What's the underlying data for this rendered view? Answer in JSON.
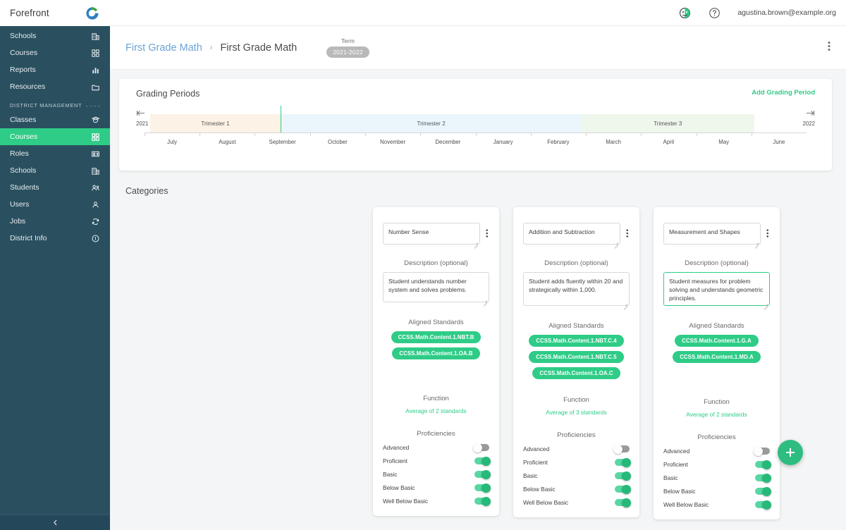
{
  "brand": {
    "name": "Forefront",
    "logo_icon": "forefront-logo-icon"
  },
  "sidebar": {
    "top_items": [
      {
        "label": "Schools",
        "icon": "building-icon"
      },
      {
        "label": "Courses",
        "icon": "grid-apps-icon"
      },
      {
        "label": "Reports",
        "icon": "bar-chart-icon"
      },
      {
        "label": "Resources",
        "icon": "folder-icon"
      }
    ],
    "section_label": "DISTRICT MANAGEMENT",
    "district_items": [
      {
        "label": "Classes",
        "icon": "graduation-cap-icon",
        "active": false
      },
      {
        "label": "Courses",
        "icon": "grid-apps-icon",
        "active": true
      },
      {
        "label": "Roles",
        "icon": "id-card-icon",
        "active": false
      },
      {
        "label": "Schools",
        "icon": "building-icon",
        "active": false
      },
      {
        "label": "Students",
        "icon": "users-icon",
        "active": false
      },
      {
        "label": "Users",
        "icon": "user-icon",
        "active": false
      },
      {
        "label": "Jobs",
        "icon": "refresh-icon",
        "active": false
      },
      {
        "label": "District Info",
        "icon": "info-circle-icon",
        "active": false
      }
    ],
    "collapse_icon": "chevron-left-icon",
    "active_color": "#2ecc87",
    "bg_color": "#2a5060"
  },
  "topbar": {
    "avatar_icon": "user-avatar-icon",
    "help_icon": "help-circle-icon",
    "user_email": "agustina.brown@example.org"
  },
  "pagehead": {
    "breadcrumb_link": "First Grade Math",
    "breadcrumb_separator": "›",
    "breadcrumb_current": "First Grade Math",
    "term_label": "Term",
    "term_value": "2021-2022",
    "menu_icon": "kebab-menu-icon"
  },
  "grading_periods": {
    "title": "Grading Periods",
    "add_label": "Add Grading Period",
    "start_year": "2021",
    "end_year": "2022",
    "start_cap_icon": "timeline-start-icon",
    "end_cap_icon": "timeline-end-icon",
    "months": [
      "July",
      "August",
      "September",
      "October",
      "November",
      "December",
      "January",
      "February",
      "March",
      "April",
      "May",
      "June"
    ],
    "bands": [
      {
        "label": "Trimester 1",
        "color": "#fdf2e6",
        "start_pct": 0.8,
        "end_pct": 20.6
      },
      {
        "label": "Trimester 2",
        "color": "#eaf6fb",
        "start_pct": 20.6,
        "end_pct": 66.0
      },
      {
        "label": "Trimester 3",
        "color": "#eff7ec",
        "start_pct": 66.0,
        "end_pct": 92.1
      }
    ],
    "marker_pct": 20.6,
    "marker_color": "#2ecc87"
  },
  "categories": {
    "title": "Categories",
    "description_label": "Description (optional)",
    "standards_label": "Aligned Standards",
    "function_label": "Function",
    "proficiencies_label": "Proficiencies",
    "add_button_icon": "plus-icon",
    "cards": [
      {
        "name": "Number Sense",
        "description": "Student understands number system and solves problems.",
        "description_focused": false,
        "standards": [
          "CCSS.Math.Content.1.NBT.B",
          "CCSS.Math.Content.1.OA.B"
        ],
        "function_value": "Average of 2 standards",
        "menu_icon": "kebab-menu-icon",
        "proficiencies": [
          {
            "label": "Advanced",
            "on": false
          },
          {
            "label": "Proficient",
            "on": true
          },
          {
            "label": "Basic",
            "on": true
          },
          {
            "label": "Below Basic",
            "on": true
          },
          {
            "label": "Well Below Basic",
            "on": true
          }
        ]
      },
      {
        "name": "Addition and Subtraction",
        "description": "Student adds fluently within 20 and strategically within 1,000.",
        "description_focused": false,
        "standards": [
          "CCSS.Math.Content.1.NBT.C.4",
          "CCSS.Math.Content.1.NBT.C.5",
          "CCSS.Math.Content.1.OA.C"
        ],
        "function_value": "Average of 3 standards",
        "menu_icon": "kebab-menu-icon",
        "proficiencies": [
          {
            "label": "Advanced",
            "on": false
          },
          {
            "label": "Proficient",
            "on": true
          },
          {
            "label": "Basic",
            "on": true
          },
          {
            "label": "Below Basic",
            "on": true
          },
          {
            "label": "Well Below Basic",
            "on": true
          }
        ]
      },
      {
        "name": "Measurement and Shapes",
        "description": "Student measures for problem solving and understands geometric principles.",
        "description_focused": true,
        "standards": [
          "CCSS.Math.Content.1.G.A",
          "CCSS.Math.Content.1.MD.A"
        ],
        "function_value": "Average of 2 standards",
        "menu_icon": "kebab-menu-icon",
        "proficiencies": [
          {
            "label": "Advanced",
            "on": false
          },
          {
            "label": "Proficient",
            "on": true
          },
          {
            "label": "Basic",
            "on": true
          },
          {
            "label": "Below Basic",
            "on": true
          },
          {
            "label": "Well Below Basic",
            "on": true
          }
        ]
      }
    ]
  },
  "colors": {
    "accent": "#2ecc87",
    "sidebar": "#2a5060",
    "link": "#6ba3d6"
  }
}
